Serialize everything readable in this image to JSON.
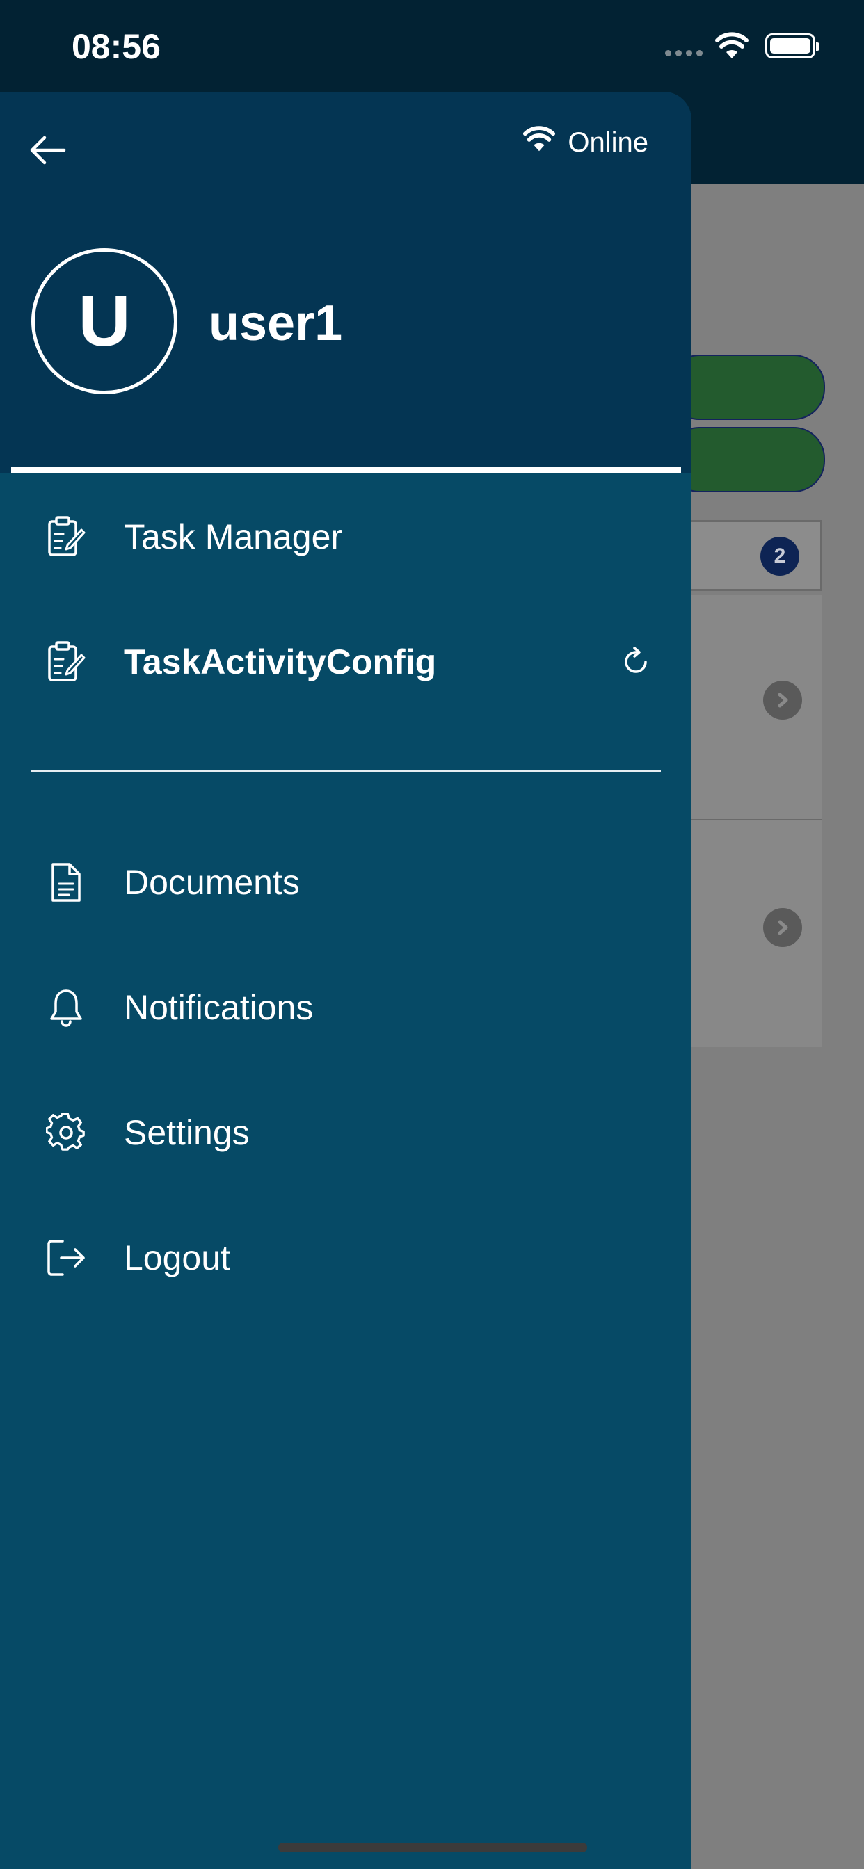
{
  "status_bar": {
    "time": "08:56"
  },
  "drawer": {
    "connection_status": "Online",
    "user": {
      "avatar_initial": "U",
      "name": "user1"
    },
    "menu_primary": [
      {
        "label": "Task Manager",
        "icon": "clipboard-edit-icon"
      },
      {
        "label": "TaskActivityConfig",
        "icon": "clipboard-edit-icon",
        "action_icon": "refresh-icon"
      }
    ],
    "menu_secondary": [
      {
        "label": "Documents",
        "icon": "document-icon"
      },
      {
        "label": "Notifications",
        "icon": "bell-icon"
      },
      {
        "label": "Settings",
        "icon": "gear-icon"
      },
      {
        "label": "Logout",
        "icon": "logout-icon"
      }
    ]
  },
  "background": {
    "filter_badge_count": "2"
  },
  "colors": {
    "drawer_bg": "#064a66",
    "drawer_header_bg": "#043553",
    "topbar_bg": "#022233",
    "pill_green": "#235b2e"
  }
}
